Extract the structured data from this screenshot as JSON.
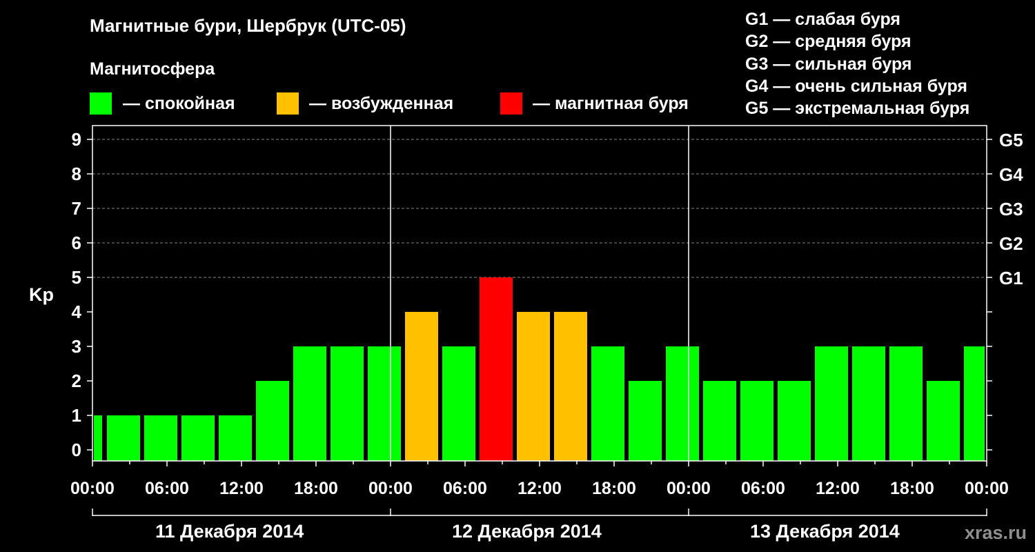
{
  "title": "Магнитные бури, Шербрук (UTC-05)",
  "magnetosphere": {
    "title": "Магнитосфера",
    "items": [
      {
        "color": "#00ff00",
        "label": "— спокойная"
      },
      {
        "color": "#ffc000",
        "label": "— возбужденная"
      },
      {
        "color": "#ff0000",
        "label": "— магнитная буря"
      }
    ]
  },
  "g_scale": [
    "G1 — слабая буря",
    "G2 — средняя буря",
    "G3 — сильная буря",
    "G4 — очень сильная буря",
    "G5 — экстремальная буря"
  ],
  "watermark": "xras.ru",
  "chart_data": {
    "type": "bar",
    "ylabel": "Kp",
    "ylim": [
      0,
      9
    ],
    "y_ticks": [
      "0",
      "1",
      "2",
      "3",
      "4",
      "5",
      "6",
      "7",
      "8",
      "9"
    ],
    "right_axis_labels": [
      {
        "kp": 5,
        "label": "G1"
      },
      {
        "kp": 6,
        "label": "G2"
      },
      {
        "kp": 7,
        "label": "G3"
      },
      {
        "kp": 8,
        "label": "G4"
      },
      {
        "kp": 9,
        "label": "G5"
      }
    ],
    "x_ticks": [
      "00:00",
      "06:00",
      "12:00",
      "18:00",
      "00:00",
      "06:00",
      "12:00",
      "18:00",
      "00:00",
      "06:00",
      "12:00",
      "18:00",
      "00:00"
    ],
    "dates": [
      "11 Декабря 2014",
      "12 Декабря 2014",
      "13 Декабря 2014"
    ],
    "colors": {
      "quiet": "#00ff00",
      "active": "#ffc000",
      "storm": "#ff0000"
    },
    "bars": [
      {
        "start_hour": 0,
        "end_hour": 1,
        "kp": 1,
        "level": "quiet"
      },
      {
        "start_hour": 1,
        "end_hour": 4,
        "kp": 1,
        "level": "quiet"
      },
      {
        "start_hour": 4,
        "end_hour": 7,
        "kp": 1,
        "level": "quiet"
      },
      {
        "start_hour": 7,
        "end_hour": 10,
        "kp": 1,
        "level": "quiet"
      },
      {
        "start_hour": 10,
        "end_hour": 13,
        "kp": 1,
        "level": "quiet"
      },
      {
        "start_hour": 13,
        "end_hour": 16,
        "kp": 2,
        "level": "quiet"
      },
      {
        "start_hour": 16,
        "end_hour": 19,
        "kp": 3,
        "level": "quiet"
      },
      {
        "start_hour": 19,
        "end_hour": 22,
        "kp": 3,
        "level": "quiet"
      },
      {
        "start_hour": 22,
        "end_hour": 25,
        "kp": 3,
        "level": "quiet"
      },
      {
        "start_hour": 25,
        "end_hour": 28,
        "kp": 4,
        "level": "active"
      },
      {
        "start_hour": 28,
        "end_hour": 31,
        "kp": 3,
        "level": "quiet"
      },
      {
        "start_hour": 31,
        "end_hour": 34,
        "kp": 5,
        "level": "storm"
      },
      {
        "start_hour": 34,
        "end_hour": 37,
        "kp": 4,
        "level": "active"
      },
      {
        "start_hour": 37,
        "end_hour": 40,
        "kp": 4,
        "level": "active"
      },
      {
        "start_hour": 40,
        "end_hour": 43,
        "kp": 3,
        "level": "quiet"
      },
      {
        "start_hour": 43,
        "end_hour": 46,
        "kp": 2,
        "level": "quiet"
      },
      {
        "start_hour": 46,
        "end_hour": 49,
        "kp": 3,
        "level": "quiet"
      },
      {
        "start_hour": 49,
        "end_hour": 52,
        "kp": 2,
        "level": "quiet"
      },
      {
        "start_hour": 52,
        "end_hour": 55,
        "kp": 2,
        "level": "quiet"
      },
      {
        "start_hour": 55,
        "end_hour": 58,
        "kp": 2,
        "level": "quiet"
      },
      {
        "start_hour": 58,
        "end_hour": 61,
        "kp": 3,
        "level": "quiet"
      },
      {
        "start_hour": 61,
        "end_hour": 64,
        "kp": 3,
        "level": "quiet"
      },
      {
        "start_hour": 64,
        "end_hour": 67,
        "kp": 3,
        "level": "quiet"
      },
      {
        "start_hour": 67,
        "end_hour": 70,
        "kp": 2,
        "level": "quiet"
      },
      {
        "start_hour": 70,
        "end_hour": 72,
        "kp": 3,
        "level": "quiet"
      }
    ]
  }
}
